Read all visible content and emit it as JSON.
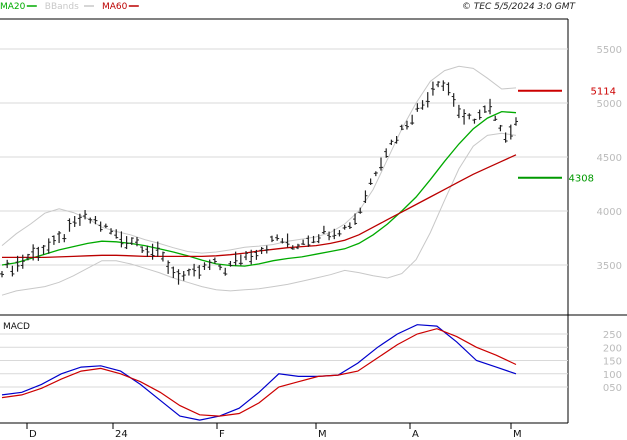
{
  "header": {
    "legend": [
      {
        "label": "MA20",
        "color": "#00aa00"
      },
      {
        "label": "BBands",
        "color": "#c8c8c8"
      },
      {
        "label": "MA60",
        "color": "#bb0000"
      }
    ],
    "copyright": "© TEC 5/5/2024 3:0 GMT"
  },
  "chart_data": [
    {
      "type": "line",
      "pane": "price",
      "title": "",
      "xlabel": "",
      "ylabel": "",
      "x_ticks": [
        "D",
        "24",
        "F",
        "M",
        "A",
        "M"
      ],
      "y_ticks": [
        "5500",
        "5000",
        "4500",
        "4000",
        "3500"
      ],
      "ylim": [
        3000,
        5800
      ],
      "grid": true,
      "levels": [
        {
          "label": "5114",
          "value": 5114,
          "color": "#cc0000"
        },
        {
          "label": "4308",
          "value": 4308,
          "color": "#009900"
        }
      ],
      "series": [
        {
          "name": "MA20",
          "color": "#00aa00",
          "values": [
            3500,
            3520,
            3560,
            3600,
            3640,
            3670,
            3700,
            3720,
            3715,
            3700,
            3680,
            3650,
            3620,
            3585,
            3545,
            3510,
            3495,
            3490,
            3510,
            3540,
            3560,
            3575,
            3600,
            3625,
            3650,
            3700,
            3780,
            3880,
            4000,
            4130,
            4290,
            4460,
            4620,
            4760,
            4860,
            4920,
            4910
          ]
        },
        {
          "name": "BBands",
          "color": "#c8c8c8",
          "values": [
            3680,
            3790,
            3880,
            3980,
            4020,
            3985,
            3930,
            3850,
            3810,
            3780,
            3735,
            3700,
            3660,
            3625,
            3610,
            3620,
            3640,
            3665,
            3675,
            3690,
            3720,
            3740,
            3760,
            3800,
            3880,
            4000,
            4200,
            4480,
            4760,
            5000,
            5200,
            5300,
            5340,
            5320,
            5230,
            5130,
            5140
          ]
        },
        {
          "name": "BBands",
          "color": "#c8c8c8",
          "values": [
            3220,
            3260,
            3280,
            3300,
            3340,
            3400,
            3470,
            3540,
            3540,
            3510,
            3470,
            3430,
            3380,
            3340,
            3300,
            3270,
            3260,
            3270,
            3280,
            3300,
            3320,
            3350,
            3380,
            3410,
            3450,
            3430,
            3400,
            3380,
            3420,
            3550,
            3800,
            4100,
            4390,
            4600,
            4700,
            4720,
            4700
          ]
        },
        {
          "name": "MA60",
          "color": "#bb0000",
          "values": [
            3570,
            3570,
            3570,
            3570,
            3575,
            3580,
            3585,
            3590,
            3590,
            3585,
            3580,
            3580,
            3580,
            3580,
            3580,
            3585,
            3595,
            3610,
            3630,
            3645,
            3660,
            3670,
            3680,
            3700,
            3730,
            3780,
            3850,
            3920,
            3990,
            4060,
            4130,
            4200,
            4270,
            4340,
            4400,
            4460,
            4520
          ]
        },
        {
          "name": "price",
          "color": "#222222",
          "values": [
            3460,
            3490,
            3580,
            3650,
            3690,
            3810,
            3935,
            3910,
            3830,
            3745,
            3735,
            3660,
            3590,
            3440,
            3380,
            3440,
            3510,
            3460,
            3560,
            3610,
            3670,
            3760,
            3660,
            3740,
            3780,
            3820,
            3840,
            3960,
            4280,
            4540,
            4700,
            4870,
            5000,
            5220,
            5120,
            4830,
            4870,
            4950,
            4680,
            4830
          ]
        }
      ]
    },
    {
      "type": "line",
      "pane": "macd",
      "title": "MACD",
      "xlabel": "",
      "ylabel": "",
      "y_ticks": [
        "250",
        "200",
        "150",
        "100",
        "050"
      ],
      "ylim": [
        -75,
        295
      ],
      "grid": true,
      "series": [
        {
          "color": "#0000cc",
          "values": [
            20,
            30,
            60,
            100,
            125,
            130,
            110,
            60,
            0,
            -60,
            -75,
            -60,
            -30,
            30,
            100,
            90,
            90,
            95,
            140,
            200,
            250,
            285,
            280,
            220,
            150,
            125,
            100
          ]
        },
        {
          "color": "#cc0000",
          "values": [
            10,
            20,
            45,
            80,
            110,
            120,
            100,
            70,
            30,
            -20,
            -55,
            -60,
            -50,
            -10,
            50,
            70,
            90,
            95,
            110,
            160,
            210,
            250,
            270,
            240,
            200,
            170,
            135
          ]
        }
      ]
    }
  ]
}
